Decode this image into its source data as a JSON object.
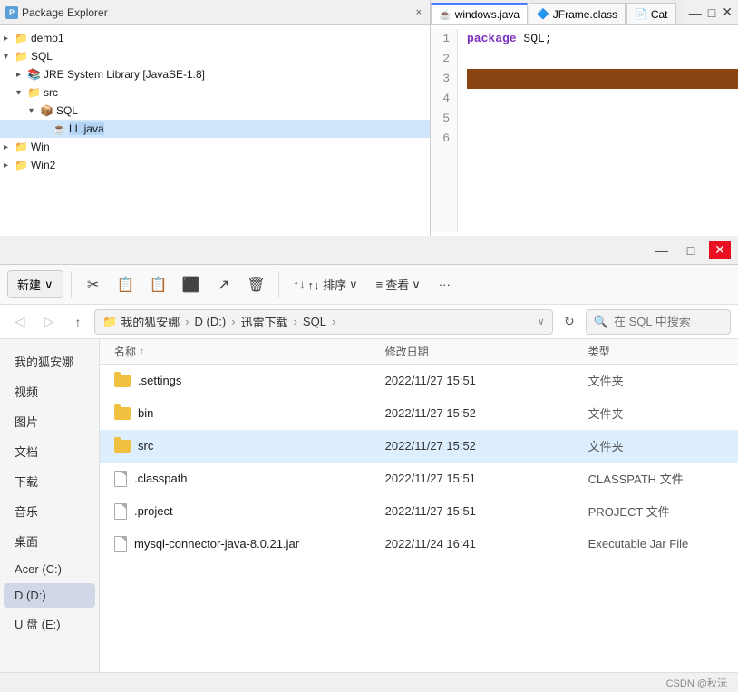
{
  "ide": {
    "packageExplorer": {
      "title": "Package Explorer",
      "closeBtn": "×",
      "tree": [
        {
          "id": "demo1",
          "indent": 0,
          "arrow": "▸",
          "icon": "📁",
          "label": "demo1",
          "selected": false
        },
        {
          "id": "sql",
          "indent": 0,
          "arrow": "▾",
          "icon": "📁",
          "label": "SQL",
          "selected": false
        },
        {
          "id": "jre",
          "indent": 1,
          "arrow": "▸",
          "icon": "📚",
          "label": "JRE System Library [JavaSE-1.8]",
          "selected": false
        },
        {
          "id": "src",
          "indent": 1,
          "arrow": "▾",
          "icon": "📁",
          "label": "src",
          "selected": false
        },
        {
          "id": "sql-pkg",
          "indent": 2,
          "arrow": "▾",
          "icon": "📦",
          "label": "SQL",
          "selected": false
        },
        {
          "id": "ll-java",
          "indent": 3,
          "arrow": "",
          "icon": "☕",
          "label": "LL.java",
          "selected": true
        },
        {
          "id": "win",
          "indent": 0,
          "arrow": "▸",
          "icon": "📁",
          "label": "Win",
          "selected": false
        },
        {
          "id": "win2",
          "indent": 0,
          "arrow": "▸",
          "icon": "📁",
          "label": "Win2",
          "selected": false
        }
      ]
    },
    "editor": {
      "tabs": [
        {
          "id": "windows-java",
          "label": "windows.java",
          "icon": "☕",
          "active": true
        },
        {
          "id": "jframe-class",
          "label": "JFrame.class",
          "icon": "🔷",
          "active": false
        },
        {
          "id": "cat",
          "label": "Cat",
          "icon": "📄",
          "active": false
        }
      ],
      "code": {
        "lines": [
          "1",
          "2",
          "3",
          "4",
          "5",
          "6"
        ],
        "content": [
          {
            "line": 1,
            "text": "package SQL;",
            "keyword": "package",
            "highlighted": false
          },
          {
            "line": 2,
            "text": "",
            "highlighted": false
          },
          {
            "line": 3,
            "text": "",
            "highlighted": true
          },
          {
            "line": 4,
            "text": "",
            "highlighted": false
          },
          {
            "line": 5,
            "text": "",
            "highlighted": false
          },
          {
            "line": 6,
            "text": "",
            "highlighted": false
          }
        ]
      }
    },
    "topToolbar": {
      "icons": [
        "⬛",
        "⬜",
        "⬛",
        "⬛",
        "⬜",
        "⬛",
        "—",
        "□",
        "✕"
      ]
    }
  },
  "fileExplorer": {
    "titleButtons": {
      "minimize": "—",
      "maximize": "□",
      "close": "✕"
    },
    "toolbar": {
      "newBtn": "新建",
      "newArrow": "∨",
      "icons": [
        "✂",
        "📋",
        "📋",
        "⬛",
        "↗",
        "🗑"
      ],
      "sortBtn": "↑↓ 排序",
      "viewBtn": "≡ 查看",
      "moreBtn": "···"
    },
    "addressBar": {
      "backDisabled": true,
      "forwardDisabled": true,
      "upBtn": "↑",
      "breadcrumbs": [
        "我的狐安娜",
        "D (D:)",
        "迅雷下载",
        "SQL"
      ],
      "breadcrumbSeps": [
        ">",
        ">",
        ">",
        ">"
      ],
      "dropdownArrow": "∨",
      "searchPlaceholder": "在 SQL 中搜索"
    },
    "sidebar": {
      "items": [
        {
          "label": "我的狐安娜",
          "selected": false
        },
        {
          "label": "视频",
          "selected": false
        },
        {
          "label": "图片",
          "selected": false
        },
        {
          "label": "文档",
          "selected": false
        },
        {
          "label": "下载",
          "selected": false
        },
        {
          "label": "音乐",
          "selected": false
        },
        {
          "label": "桌面",
          "selected": false
        },
        {
          "label": "Acer (C:)",
          "selected": false
        },
        {
          "label": "D (D:)",
          "selected": true
        },
        {
          "label": "U 盘 (E:)",
          "selected": false
        }
      ]
    },
    "table": {
      "headers": [
        "名称",
        "修改日期",
        "类型"
      ],
      "sortArrow": "↑"
    },
    "files": [
      {
        "id": "settings",
        "name": ".settings",
        "type": "folder",
        "date": "2022/11/27 15:51",
        "fileType": "文件夹"
      },
      {
        "id": "bin",
        "name": "bin",
        "type": "folder",
        "date": "2022/11/27 15:52",
        "fileType": "文件夹"
      },
      {
        "id": "src",
        "name": "src",
        "type": "folder",
        "date": "2022/11/27 15:52",
        "fileType": "文件夹",
        "selected": true
      },
      {
        "id": "classpath",
        "name": ".classpath",
        "type": "file",
        "date": "2022/11/27 15:51",
        "fileType": "CLASSPATH 文件"
      },
      {
        "id": "project",
        "name": ".project",
        "type": "file",
        "date": "2022/11/27 15:51",
        "fileType": "PROJECT 文件"
      },
      {
        "id": "mysql-jar",
        "name": "mysql-connector-java-8.0.21.jar",
        "type": "file",
        "date": "2022/11/24 16:41",
        "fileType": "Executable Jar File"
      }
    ],
    "statusBar": {
      "text": "CSDN @秋沅"
    }
  }
}
